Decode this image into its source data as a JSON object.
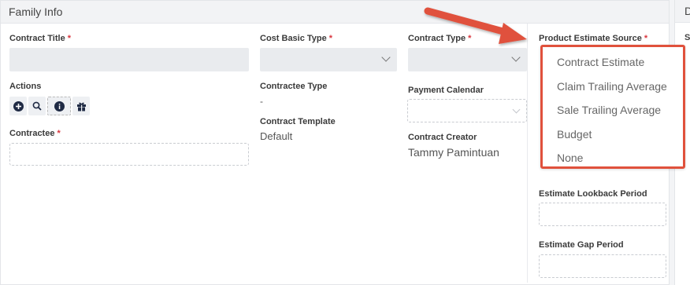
{
  "header": {
    "title": "Family Info"
  },
  "right_panel": {
    "header_initial": "D",
    "label_initial": "S"
  },
  "fields": {
    "contract_title": {
      "label": "Contract Title",
      "required": "*",
      "value": ""
    },
    "cost_basic_type": {
      "label": "Cost Basic Type",
      "required": "*",
      "value": ""
    },
    "contract_type": {
      "label": "Contract Type",
      "required": "*",
      "value": ""
    },
    "product_estimate_source": {
      "label": "Product Estimate Source",
      "required": "*"
    },
    "actions": {
      "label": "Actions"
    },
    "contractee_type": {
      "label": "Contractee Type",
      "value": "-"
    },
    "payment_calendar": {
      "label": "Payment Calendar",
      "value": ""
    },
    "contract_template": {
      "label": "Contract Template",
      "value": "Default"
    },
    "contractee": {
      "label": "Contractee",
      "required": "*",
      "value": ""
    },
    "contract_creator": {
      "label": "Contract Creator",
      "value": "Tammy Pamintuan"
    },
    "estimate_lookback_period": {
      "label": "Estimate Lookback Period",
      "value": ""
    },
    "estimate_gap_period": {
      "label": "Estimate Gap Period",
      "value": ""
    }
  },
  "action_icons": [
    "add-circle-icon",
    "search-icon",
    "info-icon",
    "gift-icon"
  ],
  "dropdown_options": [
    "Contract Estimate",
    "Claim Trailing Average",
    "Sale Trailing Average",
    "Budget",
    "None"
  ],
  "colors": {
    "required": "#d9363e",
    "highlight_border": "#e0513c",
    "arrow": "#e0513c",
    "header_bg": "#f2f3f5"
  }
}
